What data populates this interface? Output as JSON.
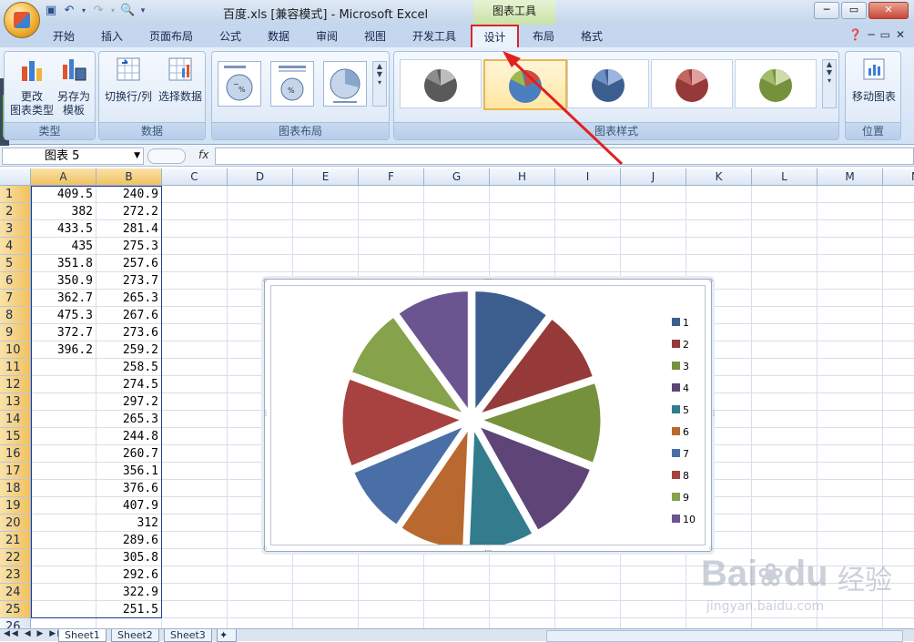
{
  "window": {
    "title": "百度.xls  [兼容模式] - Microsoft Excel",
    "context_tool": "图表工具"
  },
  "tabs": [
    "开始",
    "插入",
    "页面布局",
    "公式",
    "数据",
    "审阅",
    "视图",
    "开发工具",
    "设计",
    "布局",
    "格式"
  ],
  "active_tab": "设计",
  "ribbon": {
    "groups": {
      "type": {
        "label": "类型",
        "change_type": "更改\n图表类型",
        "save_template": "另存为\n模板"
      },
      "data": {
        "label": "数据",
        "switch_row_col": "切换行/列",
        "select_data": "选择数据"
      },
      "layout": {
        "label": "图表布局"
      },
      "styles": {
        "label": "图表样式"
      },
      "location": {
        "label": "位置",
        "move_chart": "移动图表"
      }
    }
  },
  "namebox": {
    "value": "图表 5"
  },
  "formula": {
    "fx": "fx",
    "value": ""
  },
  "columns": [
    "A",
    "B",
    "C",
    "D",
    "E",
    "F",
    "G",
    "H",
    "I",
    "J",
    "K",
    "L",
    "M",
    "N"
  ],
  "rows": [
    "1",
    "2",
    "3",
    "4",
    "5",
    "6",
    "7",
    "8",
    "9",
    "10",
    "11",
    "12",
    "13",
    "14",
    "15",
    "16",
    "17",
    "18",
    "19",
    "20",
    "21",
    "22",
    "23",
    "24",
    "25",
    "26"
  ],
  "cells": {
    "A": [
      "409.5",
      "382",
      "433.5",
      "435",
      "351.8",
      "350.9",
      "362.7",
      "475.3",
      "372.7",
      "396.2"
    ],
    "B": [
      "240.9",
      "272.2",
      "281.4",
      "275.3",
      "257.6",
      "273.7",
      "265.3",
      "267.6",
      "273.6",
      "259.2",
      "258.5",
      "274.5",
      "297.2",
      "265.3",
      "244.8",
      "260.7",
      "356.1",
      "376.6",
      "407.9",
      "312",
      "289.6",
      "305.8",
      "292.6",
      "322.9",
      "251.5"
    ]
  },
  "chart": {
    "legend": [
      "1",
      "2",
      "3",
      "4",
      "5",
      "6",
      "7",
      "8",
      "9",
      "10"
    ],
    "colors": [
      "#3b5e8f",
      "#953a38",
      "#76913c",
      "#5e4477",
      "#327c8e",
      "#b9692f",
      "#4a6fa7",
      "#a84240",
      "#86a24a",
      "#6a5590"
    ],
    "type": "exploded-pie"
  },
  "chart_data": {
    "type": "pie",
    "categories": [
      "1",
      "2",
      "3",
      "4",
      "5",
      "6",
      "7",
      "8",
      "9",
      "10"
    ],
    "values": [
      409.5,
      382,
      433.5,
      435,
      351.8,
      350.9,
      362.7,
      475.3,
      372.7,
      396.2
    ],
    "title": "",
    "legend_position": "right"
  },
  "sheets": [
    "Sheet1",
    "Sheet2",
    "Sheet3"
  ],
  "active_sheet": "Sheet1",
  "watermark": {
    "brand": "Bai",
    "brand2": "du",
    "cn": "经验",
    "url": "jingyan.baidu.com"
  }
}
